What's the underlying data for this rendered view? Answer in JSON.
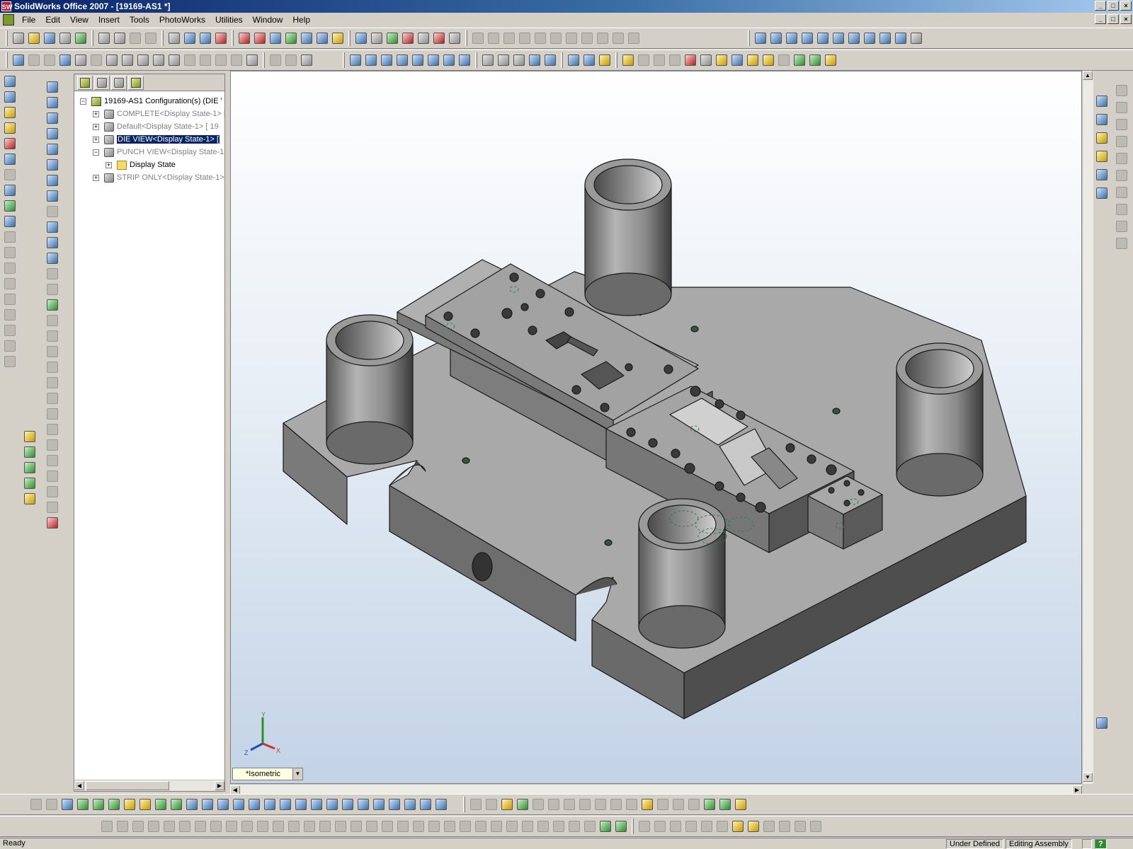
{
  "window": {
    "title": "SolidWorks Office 2007 - [19169-AS1 *]",
    "logo_text": "SW",
    "buttons": [
      "_",
      "□",
      "×"
    ]
  },
  "menu": {
    "items": [
      "File",
      "Edit",
      "View",
      "Insert",
      "Tools",
      "PhotoWorks",
      "Utilities",
      "Window",
      "Help"
    ]
  },
  "feature_manager": {
    "root_label": "19169-AS1 Configuration(s)  (DIE '",
    "configurations": [
      {
        "label": "COMPLETE<Display State-1> [",
        "selected": false,
        "expanded": false
      },
      {
        "label": "Default<Display State-1> [ 19",
        "selected": false,
        "expanded": false
      },
      {
        "label": "DIE VIEW<Display State-1> [",
        "selected": true,
        "expanded": false
      },
      {
        "label": "PUNCH VIEW<Display State-1:",
        "selected": false,
        "expanded": true
      },
      {
        "label": "Display State",
        "selected": false,
        "expanded": false,
        "child": true
      },
      {
        "label": "STRIP ONLY<Display State-1>",
        "selected": false,
        "expanded": false
      }
    ]
  },
  "viewport": {
    "view_orientation": "*Isometric",
    "triad": {
      "x": "X",
      "y": "Y",
      "z": "Z"
    },
    "background_top": "#ffffff",
    "background_bottom": "#c3d3e6"
  },
  "statusbar": {
    "status": "Ready",
    "panels": [
      "Under Defined",
      "Editing Assembly"
    ],
    "help_icon": "?"
  },
  "colors": {
    "selection": "#0a246a",
    "chrome": "#d4d0c8",
    "model_top": "#a7a7a7",
    "model_side": "#5e5e5e"
  }
}
